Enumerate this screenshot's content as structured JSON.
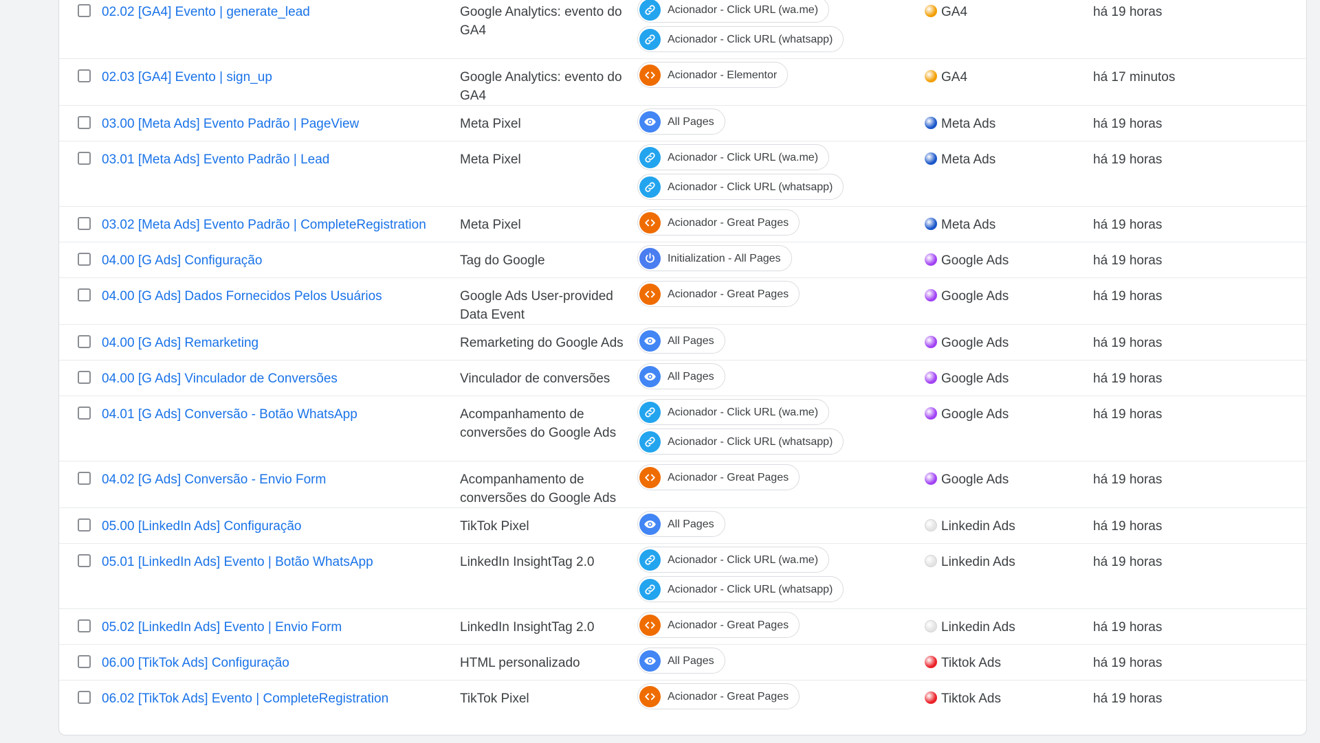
{
  "folders": {
    "GA4": "#f29f05",
    "Meta Ads": "#1a73e8",
    "Google Ads": "#a142f4",
    "Linkedin Ads": "#e8eaed",
    "Tiktok Ads": "#ea2027"
  },
  "rows": [
    {
      "name": "02.02 [GA4] Evento | generate_lead",
      "type": [
        "Google Analytics: evento do",
        "GA4"
      ],
      "triggers": [
        {
          "icon": "link-icon",
          "label": "Acionador - Click URL (wa.me)"
        },
        {
          "icon": "link-icon",
          "label": "Acionador - Click URL (whatsapp)"
        }
      ],
      "folder": "GA4",
      "folder_color": "#f29f05",
      "edited": "há 19 horas"
    },
    {
      "name": "02.03 [GA4] Evento | sign_up",
      "type": [
        "Google Analytics: evento do",
        "GA4"
      ],
      "triggers": [
        {
          "icon": "code-icon",
          "label": "Acionador - Elementor"
        }
      ],
      "folder": "GA4",
      "folder_color": "#f29f05",
      "edited": "há 17 minutos"
    },
    {
      "name": "03.00 [Meta Ads] Evento Padrão | PageView",
      "type": [
        "Meta Pixel"
      ],
      "triggers": [
        {
          "icon": "eye-icon",
          "label": "All Pages"
        }
      ],
      "folder": "Meta Ads",
      "folder_color": "#1a56c9",
      "edited": "há 19 horas"
    },
    {
      "name": "03.01 [Meta Ads] Evento Padrão | Lead",
      "type": [
        "Meta Pixel"
      ],
      "triggers": [
        {
          "icon": "link-icon",
          "label": "Acionador - Click URL (wa.me)"
        },
        {
          "icon": "link-icon",
          "label": "Acionador - Click URL (whatsapp)"
        }
      ],
      "folder": "Meta Ads",
      "folder_color": "#1a56c9",
      "edited": "há 19 horas"
    },
    {
      "name": "03.02 [Meta Ads] Evento Padrão | CompleteRegistration",
      "type": [
        "Meta Pixel"
      ],
      "triggers": [
        {
          "icon": "code-icon",
          "label": "Acionador - Great Pages"
        }
      ],
      "folder": "Meta Ads",
      "folder_color": "#1a56c9",
      "edited": "há 19 horas"
    },
    {
      "name": "04.00 [G Ads] Configuração",
      "type": [
        "Tag do Google"
      ],
      "triggers": [
        {
          "icon": "power-icon",
          "label": "Initialization - All Pages"
        }
      ],
      "folder": "Google Ads",
      "folder_color": "#a142f4",
      "edited": "há 19 horas"
    },
    {
      "name": "04.00 [G Ads] Dados Fornecidos Pelos Usuários",
      "type": [
        "Google Ads User-provided",
        "Data Event"
      ],
      "triggers": [
        {
          "icon": "code-icon",
          "label": "Acionador - Great Pages"
        }
      ],
      "folder": "Google Ads",
      "folder_color": "#a142f4",
      "edited": "há 19 horas"
    },
    {
      "name": "04.00 [G Ads] Remarketing",
      "type": [
        "Remarketing do Google Ads"
      ],
      "triggers": [
        {
          "icon": "eye-icon",
          "label": "All Pages"
        }
      ],
      "folder": "Google Ads",
      "folder_color": "#a142f4",
      "edited": "há 19 horas"
    },
    {
      "name": "04.00 [G Ads] Vinculador de Conversões",
      "type": [
        "Vinculador de conversões"
      ],
      "triggers": [
        {
          "icon": "eye-icon",
          "label": "All Pages"
        }
      ],
      "folder": "Google Ads",
      "folder_color": "#a142f4",
      "edited": "há 19 horas"
    },
    {
      "name": "04.01 [G Ads] Conversão - Botão WhatsApp",
      "type": [
        "Acompanhamento de",
        "conversões do Google Ads"
      ],
      "triggers": [
        {
          "icon": "link-icon",
          "label": "Acionador - Click URL (wa.me)"
        },
        {
          "icon": "link-icon",
          "label": "Acionador - Click URL (whatsapp)"
        }
      ],
      "folder": "Google Ads",
      "folder_color": "#a142f4",
      "edited": "há 19 horas"
    },
    {
      "name": "04.02 [G Ads] Conversão - Envio Form",
      "type": [
        "Acompanhamento de",
        "conversões do Google Ads"
      ],
      "triggers": [
        {
          "icon": "code-icon",
          "label": "Acionador - Great Pages"
        }
      ],
      "folder": "Google Ads",
      "folder_color": "#a142f4",
      "edited": "há 19 horas"
    },
    {
      "name": "05.00 [LinkedIn Ads] Configuração",
      "type": [
        "TikTok Pixel"
      ],
      "triggers": [
        {
          "icon": "eye-icon",
          "label": "All Pages"
        }
      ],
      "folder": "Linkedin Ads",
      "folder_color": "#e3e3e3",
      "edited": "há 19 horas"
    },
    {
      "name": "05.01 [LinkedIn Ads] Evento | Botão WhatsApp",
      "type": [
        "LinkedIn InsightTag 2.0"
      ],
      "triggers": [
        {
          "icon": "link-icon",
          "label": "Acionador - Click URL (wa.me)"
        },
        {
          "icon": "link-icon",
          "label": "Acionador - Click URL (whatsapp)"
        }
      ],
      "folder": "Linkedin Ads",
      "folder_color": "#e3e3e3",
      "edited": "há 19 horas"
    },
    {
      "name": "05.02 [LinkedIn Ads] Evento | Envio Form",
      "type": [
        "LinkedIn InsightTag 2.0"
      ],
      "triggers": [
        {
          "icon": "code-icon",
          "label": "Acionador - Great Pages"
        }
      ],
      "folder": "Linkedin Ads",
      "folder_color": "#e3e3e3",
      "edited": "há 19 horas"
    },
    {
      "name": "06.00 [TikTok Ads] Configuração",
      "type": [
        "HTML personalizado"
      ],
      "triggers": [
        {
          "icon": "eye-icon",
          "label": "All Pages"
        }
      ],
      "folder": "Tiktok Ads",
      "folder_color": "#ea2027",
      "edited": "há 19 horas"
    },
    {
      "name": "06.02 [TikTok Ads] Evento | CompleteRegistration",
      "type": [
        "TikTok Pixel"
      ],
      "triggers": [
        {
          "icon": "code-icon",
          "label": "Acionador - Great Pages"
        }
      ],
      "folder": "Tiktok Ads",
      "folder_color": "#ea2027",
      "edited": "há 19 horas"
    }
  ]
}
